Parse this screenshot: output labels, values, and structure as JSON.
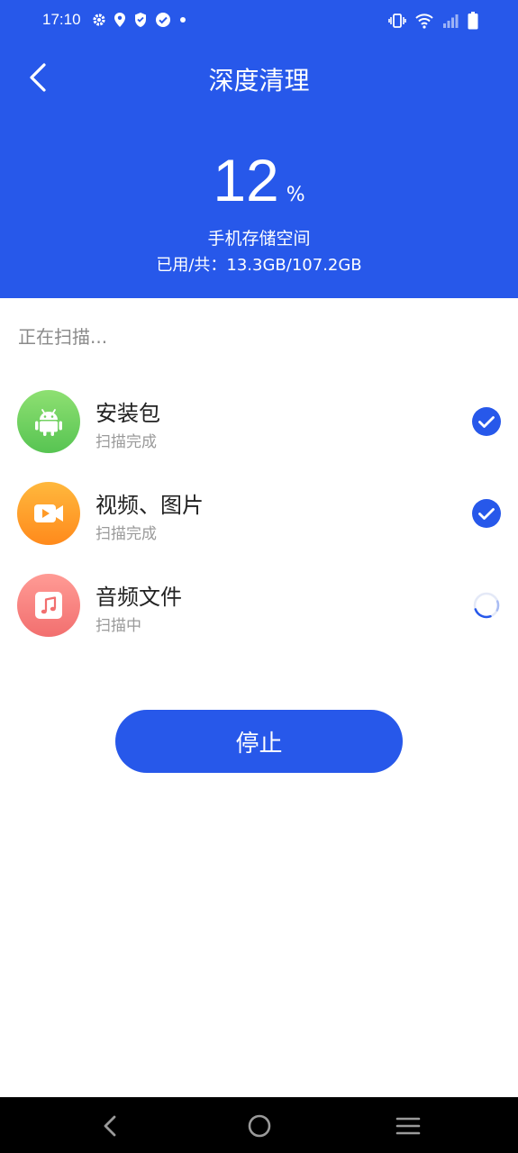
{
  "status_bar": {
    "time": "17:10"
  },
  "header": {
    "title": "深度清理",
    "back_icon": "chevron-left-icon",
    "accent_color": "#2758ea"
  },
  "storage": {
    "percent": "12",
    "percent_unit": "%",
    "label": "手机存储空间",
    "usage": "已用/共：13.3GB/107.2GB"
  },
  "scan": {
    "status_text": "正在扫描...",
    "items": [
      {
        "name": "安装包",
        "status": "扫描完成",
        "icon": "android-icon",
        "state": "done"
      },
      {
        "name": "视频、图片",
        "status": "扫描完成",
        "icon": "video-icon",
        "state": "done"
      },
      {
        "name": "音频文件",
        "status": "扫描中",
        "icon": "music-icon",
        "state": "scanning"
      }
    ]
  },
  "actions": {
    "stop_label": "停止"
  }
}
